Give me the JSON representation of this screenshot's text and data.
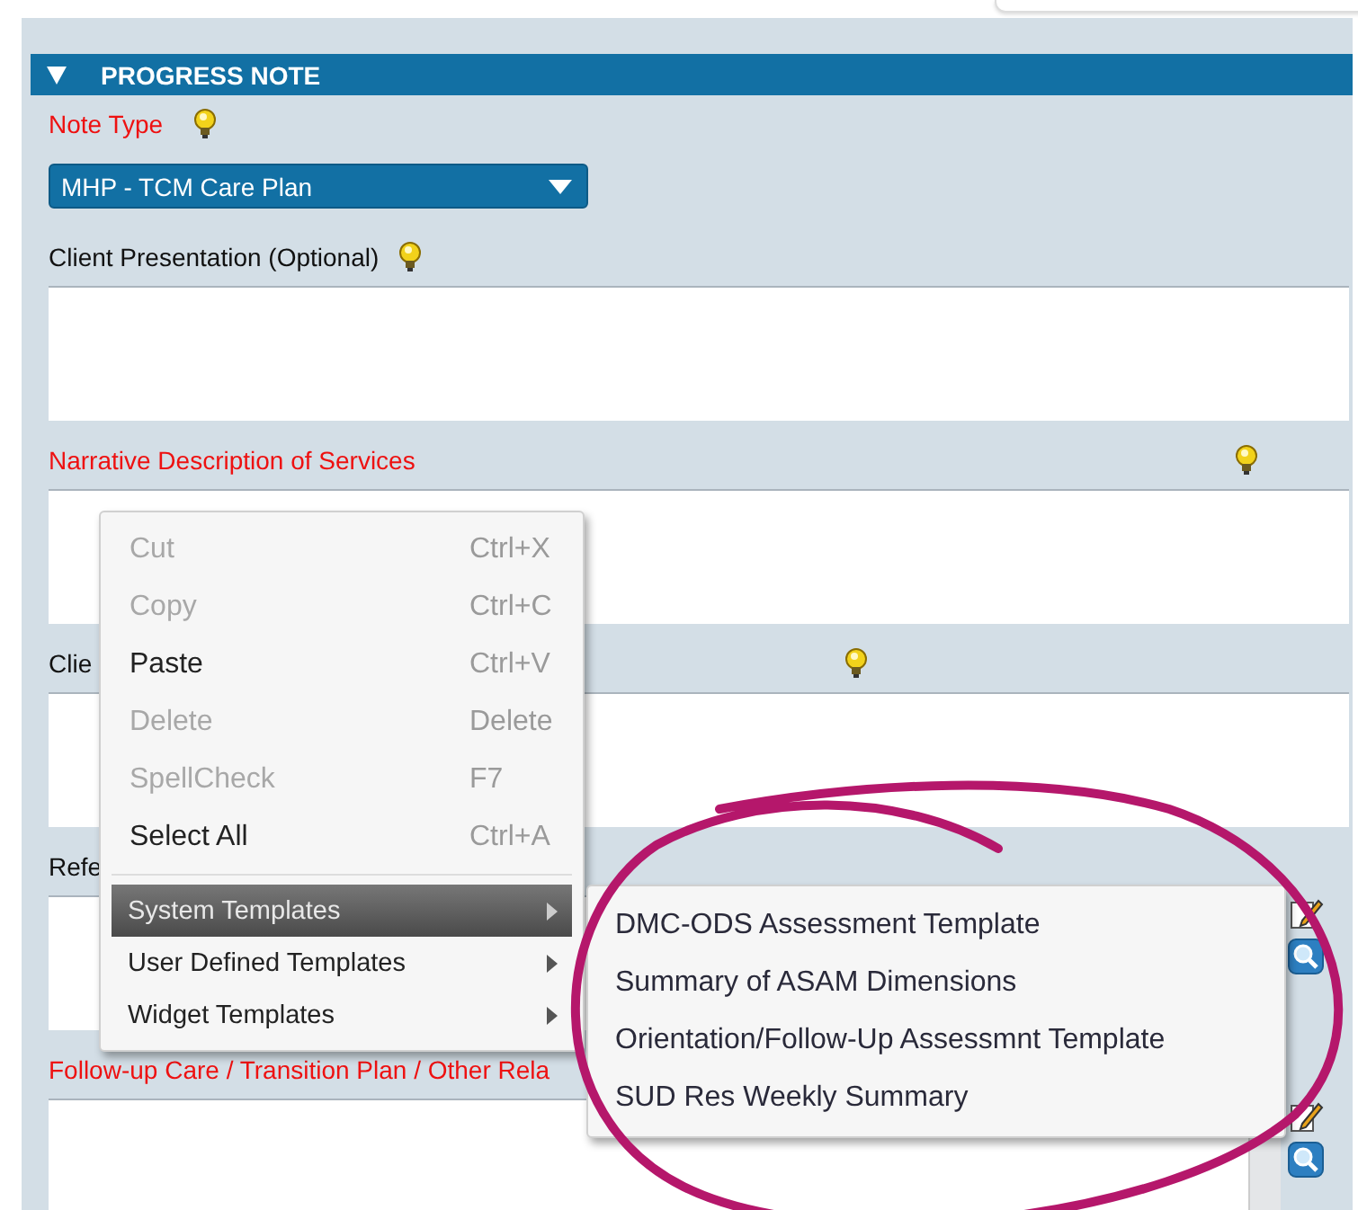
{
  "section": {
    "title": "PROGRESS NOTE",
    "expanded": true
  },
  "fields": [
    {
      "kind": "select",
      "label": "Note Type",
      "required": true,
      "hint": true,
      "value": "MHP - TCM Care Plan"
    },
    {
      "kind": "textarea",
      "label": "Client Presentation (Optional)",
      "required": false,
      "hint": true,
      "editor_tools": false,
      "scrollbar": false
    },
    {
      "kind": "textarea",
      "label": "Narrative Description of Services",
      "required": true,
      "hint": true,
      "editor_tools": false,
      "scrollbar": false
    },
    {
      "kind": "textarea",
      "label": "Clie",
      "required": false,
      "hint": true,
      "editor_tools": false,
      "scrollbar": false
    },
    {
      "kind": "textarea",
      "label": "Refe",
      "required": false,
      "hint": false,
      "editor_tools": true,
      "scrollbar": false
    },
    {
      "kind": "textarea",
      "label": "Follow-up Care / Transition Plan / Other Rela",
      "required": true,
      "hint": false,
      "editor_tools": true,
      "scrollbar": true
    }
  ],
  "context_menu": {
    "items": [
      {
        "kind": "command",
        "label": "Cut",
        "shortcut": "Ctrl+X",
        "disabled": true
      },
      {
        "kind": "command",
        "label": "Copy",
        "shortcut": "Ctrl+C",
        "disabled": true
      },
      {
        "kind": "command",
        "label": "Paste",
        "shortcut": "Ctrl+V",
        "disabled": false
      },
      {
        "kind": "command",
        "label": "Delete",
        "shortcut": "Delete",
        "disabled": true
      },
      {
        "kind": "command",
        "label": "SpellCheck",
        "shortcut": "F7",
        "disabled": true
      },
      {
        "kind": "command",
        "label": "Select All",
        "shortcut": "Ctrl+A",
        "disabled": false
      },
      {
        "kind": "submenu",
        "label": "System Templates",
        "selected": true
      },
      {
        "kind": "submenu",
        "label": "User Defined Templates",
        "selected": false
      },
      {
        "kind": "submenu",
        "label": "Widget Templates",
        "selected": false
      }
    ],
    "submenu": {
      "items": [
        {
          "label": "DMC-ODS Assessment Template"
        },
        {
          "label": "Summary of ASAM Dimensions"
        },
        {
          "label": "Orientation/Follow-Up Assessmnt Template"
        },
        {
          "label": "SUD Res Weekly Summary"
        }
      ]
    }
  },
  "annotation": {
    "kind": "ellipse"
  }
}
